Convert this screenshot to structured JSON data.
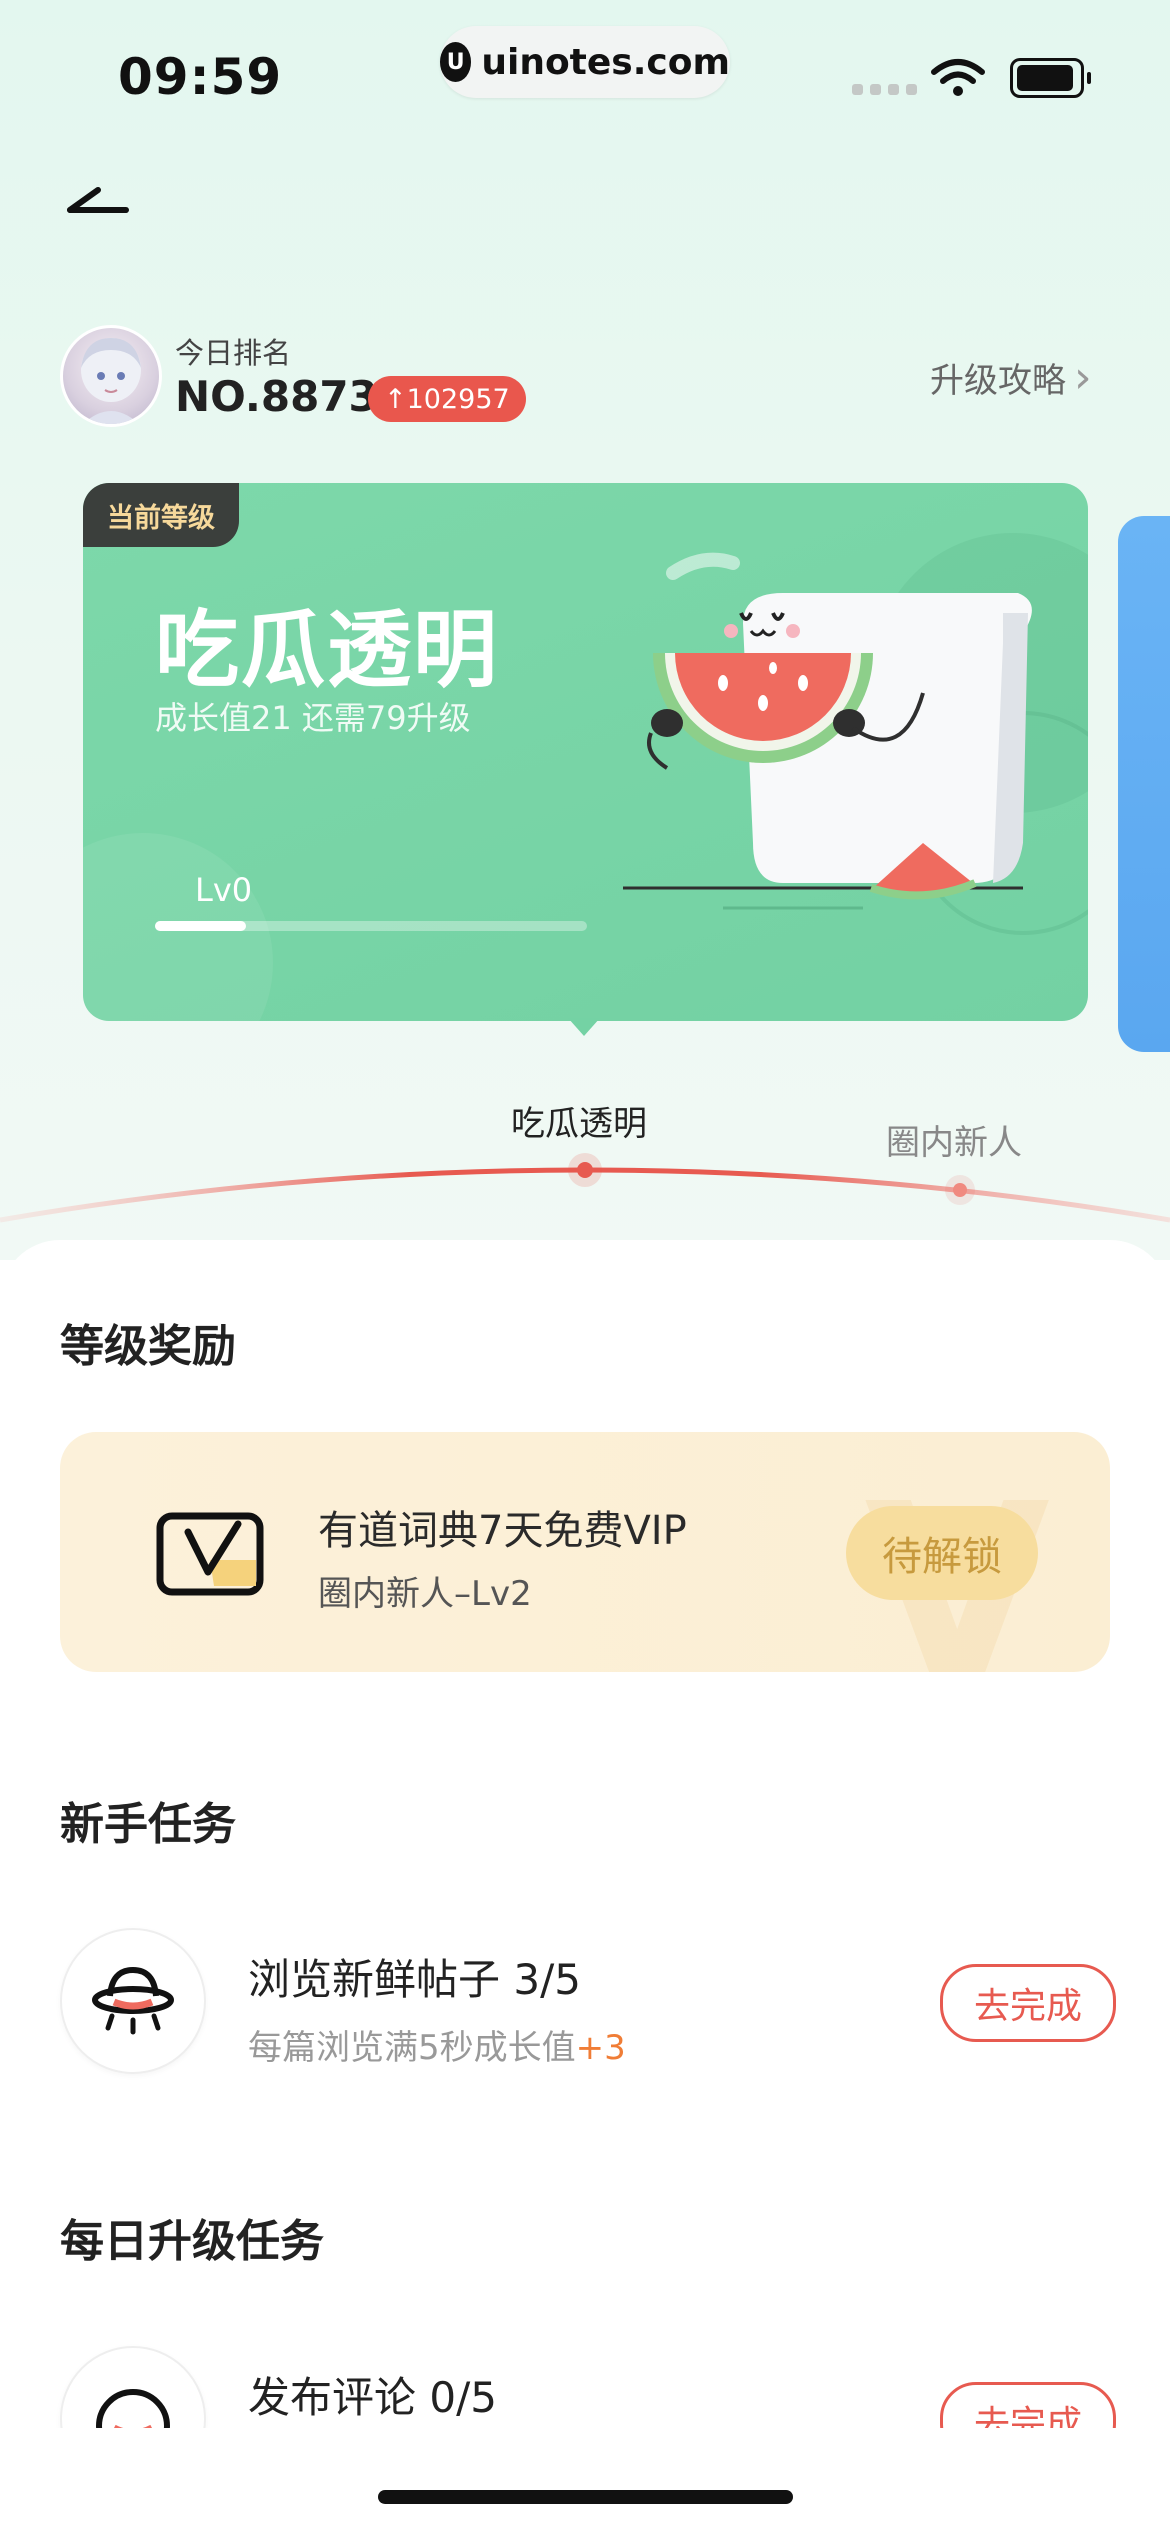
{
  "status_bar": {
    "time": "09:59",
    "url": "uinotes.com",
    "logo_glyph": "U"
  },
  "header": {
    "back_icon": "back-arrow-icon"
  },
  "ranking": {
    "label": "今日排名",
    "value": "NO.8873",
    "change": "↑102957",
    "guide_label": "升级攻略",
    "guide_chevron": "›"
  },
  "level_card": {
    "tag": "当前等级",
    "title": "吃瓜透明",
    "subtitle": "成长值21 还需79升级",
    "level": "Lv0",
    "progress": 0.21
  },
  "level_track": {
    "current": "吃瓜透明",
    "next": "圈内新人"
  },
  "rewards": {
    "title": "等级奖励",
    "item_title": "有道词典7天免费VIP",
    "item_sub": "圈内新人–Lv2",
    "button": "待解锁",
    "watermark": "V"
  },
  "newbie_tasks": {
    "title": "新手任务",
    "tasks": [
      {
        "name": "浏览新鲜帖子 3/5",
        "desc": "每篇浏览满5秒成长值",
        "bonus": "+3",
        "button": "去完成",
        "icon": "ufo-icon"
      }
    ]
  },
  "daily_tasks": {
    "title": "每日升级任务",
    "tasks": [
      {
        "name": "发布评论 0/5",
        "button": "去完成",
        "icon": "comment-icon"
      }
    ]
  },
  "colors": {
    "accent_red": "#e75a50",
    "card_green": "#77d4a6",
    "gold": "#f7dd9e"
  }
}
